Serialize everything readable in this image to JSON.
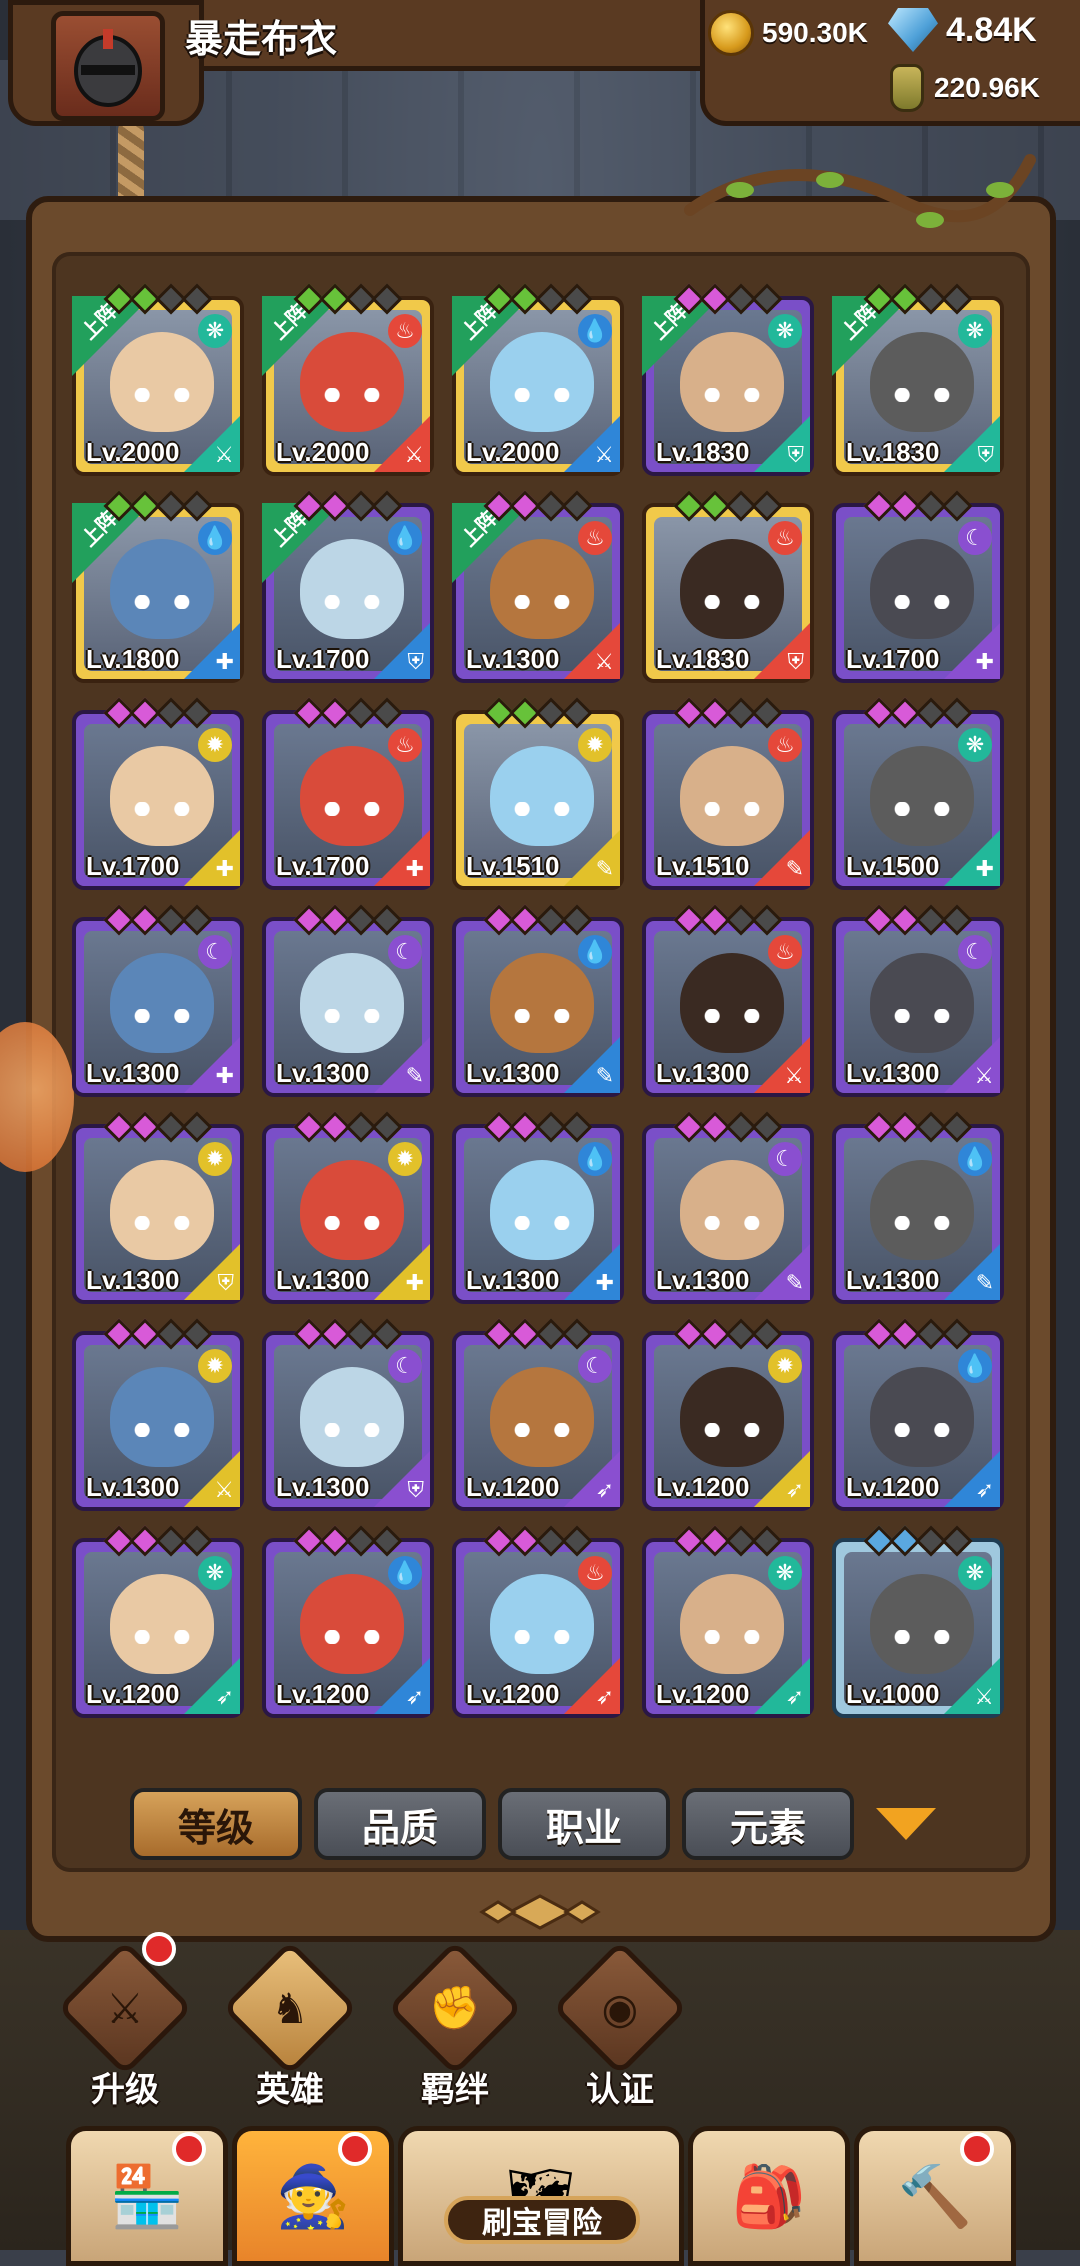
{
  "player": {
    "name": "暴走布衣"
  },
  "resources": {
    "gold": "590.30K",
    "gems": "4.84K",
    "potion": "220.96K"
  },
  "heroes": [
    {
      "level": "Lv.2000",
      "rarity": "gold",
      "deployed": true,
      "element": "wind",
      "role": "sword"
    },
    {
      "level": "Lv.2000",
      "rarity": "gold",
      "deployed": true,
      "element": "fire",
      "role": "sword"
    },
    {
      "level": "Lv.2000",
      "rarity": "gold",
      "deployed": true,
      "element": "water",
      "role": "sword"
    },
    {
      "level": "Lv.1830",
      "rarity": "purple",
      "deployed": true,
      "element": "wind",
      "role": "shield"
    },
    {
      "level": "Lv.1830",
      "rarity": "gold",
      "deployed": true,
      "element": "wind",
      "role": "shield"
    },
    {
      "level": "Lv.1800",
      "rarity": "gold",
      "deployed": true,
      "element": "water",
      "role": "heal"
    },
    {
      "level": "Lv.1700",
      "rarity": "purple",
      "deployed": true,
      "element": "water",
      "role": "shield"
    },
    {
      "level": "Lv.1300",
      "rarity": "purple",
      "deployed": true,
      "element": "fire",
      "role": "sword"
    },
    {
      "level": "Lv.1830",
      "rarity": "gold",
      "deployed": false,
      "element": "fire",
      "role": "shield"
    },
    {
      "level": "Lv.1700",
      "rarity": "purple",
      "deployed": false,
      "element": "dark",
      "role": "heal"
    },
    {
      "level": "Lv.1700",
      "rarity": "purple",
      "deployed": false,
      "element": "light",
      "role": "heal"
    },
    {
      "level": "Lv.1700",
      "rarity": "purple",
      "deployed": false,
      "element": "fire",
      "role": "heal"
    },
    {
      "level": "Lv.1510",
      "rarity": "gold",
      "deployed": false,
      "element": "light",
      "role": "staff"
    },
    {
      "level": "Lv.1510",
      "rarity": "purple",
      "deployed": false,
      "element": "fire",
      "role": "staff"
    },
    {
      "level": "Lv.1500",
      "rarity": "purple",
      "deployed": false,
      "element": "wind",
      "role": "heal"
    },
    {
      "level": "Lv.1300",
      "rarity": "purple",
      "deployed": false,
      "element": "dark",
      "role": "heal"
    },
    {
      "level": "Lv.1300",
      "rarity": "purple",
      "deployed": false,
      "element": "dark",
      "role": "staff"
    },
    {
      "level": "Lv.1300",
      "rarity": "purple",
      "deployed": false,
      "element": "water",
      "role": "staff"
    },
    {
      "level": "Lv.1300",
      "rarity": "purple",
      "deployed": false,
      "element": "fire",
      "role": "sword"
    },
    {
      "level": "Lv.1300",
      "rarity": "purple",
      "deployed": false,
      "element": "dark",
      "role": "sword"
    },
    {
      "level": "Lv.1300",
      "rarity": "purple",
      "deployed": false,
      "element": "light",
      "role": "shield"
    },
    {
      "level": "Lv.1300",
      "rarity": "purple",
      "deployed": false,
      "element": "light",
      "role": "heal"
    },
    {
      "level": "Lv.1300",
      "rarity": "purple",
      "deployed": false,
      "element": "water",
      "role": "heal"
    },
    {
      "level": "Lv.1300",
      "rarity": "purple",
      "deployed": false,
      "element": "dark",
      "role": "staff"
    },
    {
      "level": "Lv.1300",
      "rarity": "purple",
      "deployed": false,
      "element": "water",
      "role": "staff"
    },
    {
      "level": "Lv.1300",
      "rarity": "purple",
      "deployed": false,
      "element": "light",
      "role": "sword"
    },
    {
      "level": "Lv.1300",
      "rarity": "purple",
      "deployed": false,
      "element": "dark",
      "role": "shield"
    },
    {
      "level": "Lv.1200",
      "rarity": "purple",
      "deployed": false,
      "element": "dark",
      "role": "bow"
    },
    {
      "level": "Lv.1200",
      "rarity": "purple",
      "deployed": false,
      "element": "light",
      "role": "bow"
    },
    {
      "level": "Lv.1200",
      "rarity": "purple",
      "deployed": false,
      "element": "water",
      "role": "bow"
    },
    {
      "level": "Lv.1200",
      "rarity": "purple",
      "deployed": false,
      "element": "wind",
      "role": "bow"
    },
    {
      "level": "Lv.1200",
      "rarity": "purple",
      "deployed": false,
      "element": "water",
      "role": "bow"
    },
    {
      "level": "Lv.1200",
      "rarity": "purple",
      "deployed": false,
      "element": "fire",
      "role": "bow"
    },
    {
      "level": "Lv.1200",
      "rarity": "purple",
      "deployed": false,
      "element": "wind",
      "role": "bow"
    },
    {
      "level": "Lv.1000",
      "rarity": "blue",
      "deployed": false,
      "element": "wind",
      "role": "sword"
    }
  ],
  "deployed_tag": "上阵",
  "sort_buttons": [
    "等级",
    "品质",
    "职业",
    "元素"
  ],
  "sub_tabs": [
    {
      "label": "升级",
      "badge": true
    },
    {
      "label": "英雄",
      "badge": false
    },
    {
      "label": "羁绊",
      "badge": false
    },
    {
      "label": "认证",
      "badge": false
    }
  ],
  "bottom_nav": {
    "adventure_label": "刷宝冒险"
  },
  "colors": {
    "wind": "#22b89a",
    "fire": "#e5483a",
    "water": "#2f86d8",
    "dark": "#8a4fd0",
    "light": "#e2c12a",
    "sword": "#2aa35f",
    "shield": "#2aa35f",
    "heal": "#3b6ed8",
    "staff": "#8a4fd0",
    "bow": "#2aa35f"
  }
}
